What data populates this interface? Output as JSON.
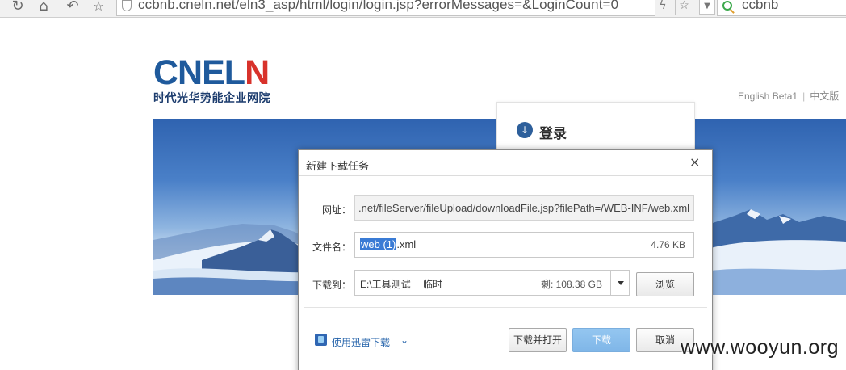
{
  "browser": {
    "address": "ccbnb.cneln.net/eln3_asp/html/login/login.jsp?errorMessages=&LoginCount=0",
    "search_query": "ccbnb",
    "icons": [
      "refresh-icon",
      "home-icon",
      "back-icon",
      "star-icon",
      "shield-icon",
      "lightning-icon",
      "bookmark-star-icon",
      "dropdown-icon",
      "search-engine-icon"
    ]
  },
  "page": {
    "logo_text_blue": "CNEL",
    "logo_text_red": "N",
    "logo_subtitle": "时代光华势能企业网院",
    "lang_english": "English Beta1",
    "lang_chinese": "中文版",
    "login_title": "登录",
    "colors": {
      "logo_blue": "#1f5a9c",
      "logo_red": "#d8322b"
    }
  },
  "dialog": {
    "title": "新建下载任务",
    "close_glyph": "×",
    "url_label": "网址：",
    "url_value": ".net/fileServer/fileUpload/downloadFile.jsp?filePath=/WEB-INF/web.xml",
    "filename_label": "文件名：",
    "filename_selected": "web (1)",
    "filename_ext": ".xml",
    "filesize": "4.76 KB",
    "saveto_label": "下载到：",
    "saveto_path": "E:\\工具测试 一临时",
    "free_space": "剩: 108.38 GB",
    "browse_button": "浏览",
    "thunder_link": "使用迅雷下载",
    "thunder_chevron": "⌄",
    "download_open_button": "下载并打开",
    "download_button": "下载",
    "cancel_button": "取消"
  },
  "watermark": "www.wooyun.org"
}
